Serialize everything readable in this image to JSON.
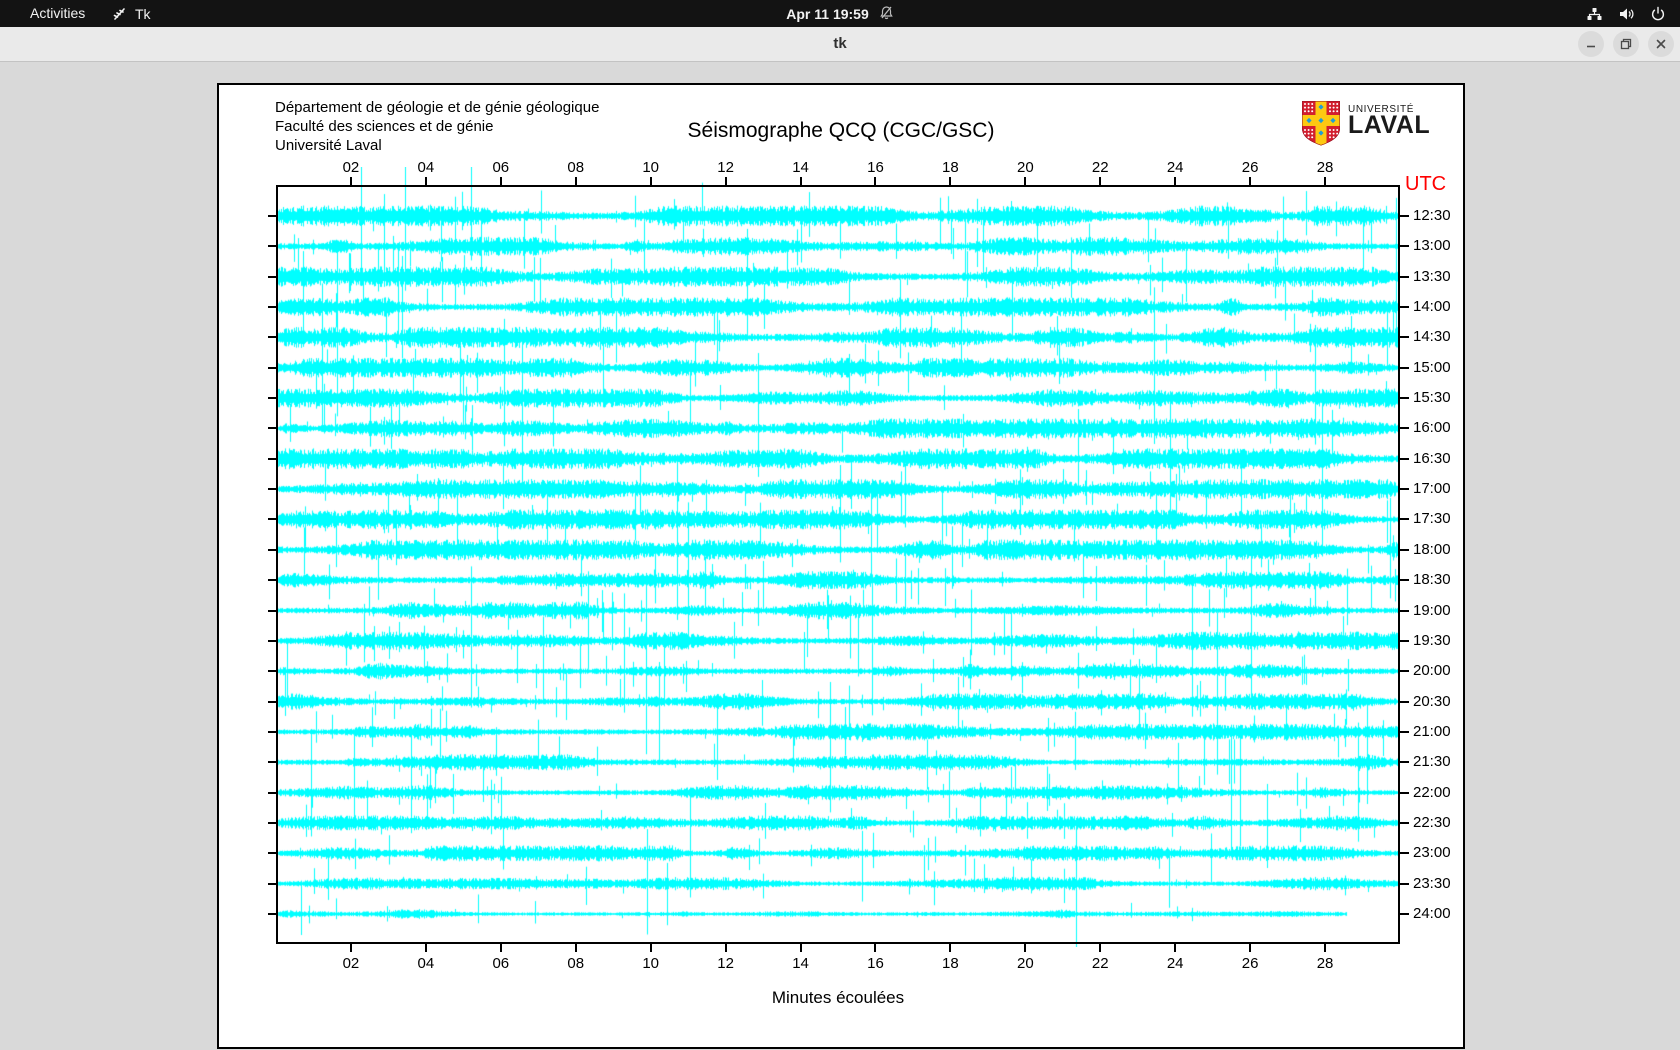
{
  "window": {
    "topbar": {
      "activities_label": "Activities",
      "app_menu_label": "Tk",
      "clock": "Apr 11 19:59"
    },
    "titlebar": {
      "title": "tk"
    }
  },
  "canvas_header": {
    "dept_line1": "Département de géologie et de génie géologique",
    "dept_line2": "Faculté des sciences et de génie",
    "dept_line3": "Université Laval"
  },
  "logo": {
    "top_text": "UNIVERSITÉ",
    "bottom_text": "LAVAL",
    "shield_red": "#d21e2f",
    "shield_gold": "#fdc912",
    "shield_blue": "#1e9cd7"
  },
  "chart_data": {
    "type": "seismogram",
    "title": "Séismographe QCQ (CGC/GSC)",
    "xlabel": "Minutes écoulées",
    "right_axis_label": "UTC",
    "right_axis_label_color": "#ff0000",
    "trace_color": "#00ffff",
    "x_range_minutes": [
      0,
      30
    ],
    "x_tick_labels": [
      "02",
      "04",
      "06",
      "08",
      "10",
      "12",
      "14",
      "16",
      "18",
      "20",
      "22",
      "24",
      "26",
      "28"
    ],
    "traces": [
      {
        "utc": "12:30",
        "activity": 0.95,
        "end": 1
      },
      {
        "utc": "13:00",
        "activity": 0.85,
        "end": 1
      },
      {
        "utc": "13:30",
        "activity": 0.92,
        "end": 1
      },
      {
        "utc": "14:00",
        "activity": 0.85,
        "end": 1
      },
      {
        "utc": "14:30",
        "activity": 1.0,
        "end": 1
      },
      {
        "utc": "15:00",
        "activity": 0.9,
        "end": 1
      },
      {
        "utc": "15:30",
        "activity": 0.85,
        "end": 1
      },
      {
        "utc": "16:00",
        "activity": 0.9,
        "end": 1
      },
      {
        "utc": "16:30",
        "activity": 0.95,
        "end": 1
      },
      {
        "utc": "17:00",
        "activity": 0.9,
        "end": 1
      },
      {
        "utc": "17:30",
        "activity": 0.9,
        "end": 1
      },
      {
        "utc": "18:00",
        "activity": 0.95,
        "end": 1
      },
      {
        "utc": "18:30",
        "activity": 0.8,
        "end": 1
      },
      {
        "utc": "19:00",
        "activity": 0.75,
        "end": 1
      },
      {
        "utc": "19:30",
        "activity": 0.8,
        "end": 1
      },
      {
        "utc": "20:00",
        "activity": 0.75,
        "end": 1
      },
      {
        "utc": "20:30",
        "activity": 0.7,
        "end": 1
      },
      {
        "utc": "21:00",
        "activity": 0.7,
        "end": 1
      },
      {
        "utc": "21:30",
        "activity": 0.65,
        "end": 1
      },
      {
        "utc": "22:00",
        "activity": 0.6,
        "end": 1
      },
      {
        "utc": "22:30",
        "activity": 0.6,
        "end": 1
      },
      {
        "utc": "23:00",
        "activity": 0.65,
        "end": 1
      },
      {
        "utc": "23:30",
        "activity": 0.5,
        "end": 1
      },
      {
        "utc": "24:00",
        "activity": 0.3,
        "end": 0.954
      }
    ]
  }
}
